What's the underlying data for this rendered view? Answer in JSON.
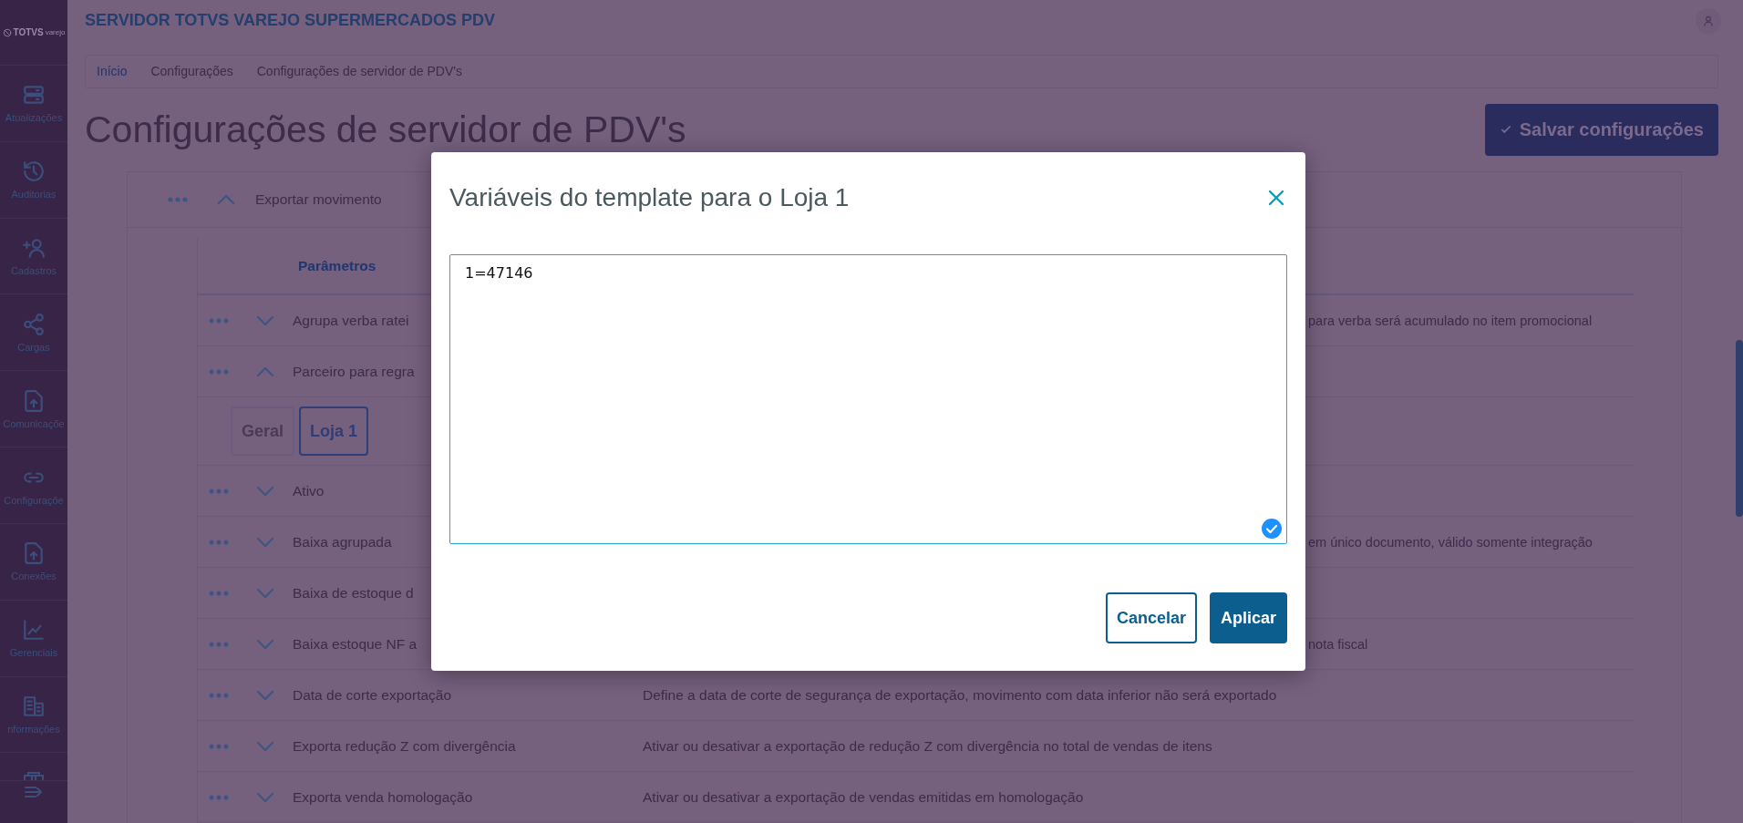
{
  "sidebar": {
    "logo": "TOTVS",
    "logo_sub": "varejo",
    "items": [
      {
        "label": "Atualizações"
      },
      {
        "label": "Auditorias"
      },
      {
        "label": "Cadastros"
      },
      {
        "label": "Cargas"
      },
      {
        "label": "Comunicaçõe"
      },
      {
        "label": "Configuraçõe"
      },
      {
        "label": "Conexões"
      },
      {
        "label": "Gerenciais"
      },
      {
        "label": "nformações"
      }
    ]
  },
  "header": {
    "title": "SERVIDOR TOTVS VAREJO SUPERMERCADOS PDV"
  },
  "breadcrumbs": [
    {
      "label": "Início",
      "kind": "link"
    },
    {
      "label": "Configurações",
      "kind": "text"
    },
    {
      "label": "Configurações de servidor de PDV's",
      "kind": "text"
    }
  ],
  "page": {
    "title": "Configurações de servidor de PDV's",
    "save_button": "Salvar configurações"
  },
  "section": {
    "label": "Exportar movimento",
    "expanded": true,
    "table": {
      "columns": [
        "Parâmetros"
      ],
      "rows": [
        {
          "kind": "parameter",
          "parameter": "Agrupa verba ratei",
          "description": "para verba será acumulado no item promocional",
          "expanded": false
        },
        {
          "kind": "parameter",
          "parameter": "Parceiro para regra",
          "expanded": true
        },
        {
          "kind": "tabs",
          "tabs": [
            {
              "label": "Geral",
              "selected": false
            },
            {
              "label": "Loja 1",
              "selected": true
            }
          ]
        },
        {
          "kind": "parameter",
          "parameter": "Ativo",
          "expanded": false
        },
        {
          "kind": "parameter",
          "parameter": "Baixa agrupada",
          "description": "em único documento, válido somente integração",
          "expanded": false
        },
        {
          "kind": "parameter",
          "parameter": "Baixa de estoque d",
          "expanded": false
        },
        {
          "kind": "parameter",
          "parameter": "Baixa estoque NF a",
          "description": "nota fiscal",
          "expanded": false
        },
        {
          "kind": "parameter",
          "parameter": "Data de corte exportação",
          "description": "Define a data de corte de segurança de exportação, movimento com data inferior não será exportado",
          "expanded": false
        },
        {
          "kind": "parameter",
          "parameter": "Exporta redução Z com divergência",
          "description": "Ativar ou desativar a exportação de redução Z com divergência no total de vendas de itens",
          "expanded": false
        },
        {
          "kind": "parameter",
          "parameter": "Exporta venda homologação",
          "description": "Ativar ou desativar a exportação de vendas emitidas em homologação",
          "expanded": false
        }
      ]
    }
  },
  "modal": {
    "title": "Variáveis do template para o Loja 1",
    "value": "1=47146",
    "buttons": [
      {
        "label": "Cancelar",
        "kind": "secondary"
      },
      {
        "label": "Aplicar",
        "kind": "primary"
      }
    ]
  }
}
